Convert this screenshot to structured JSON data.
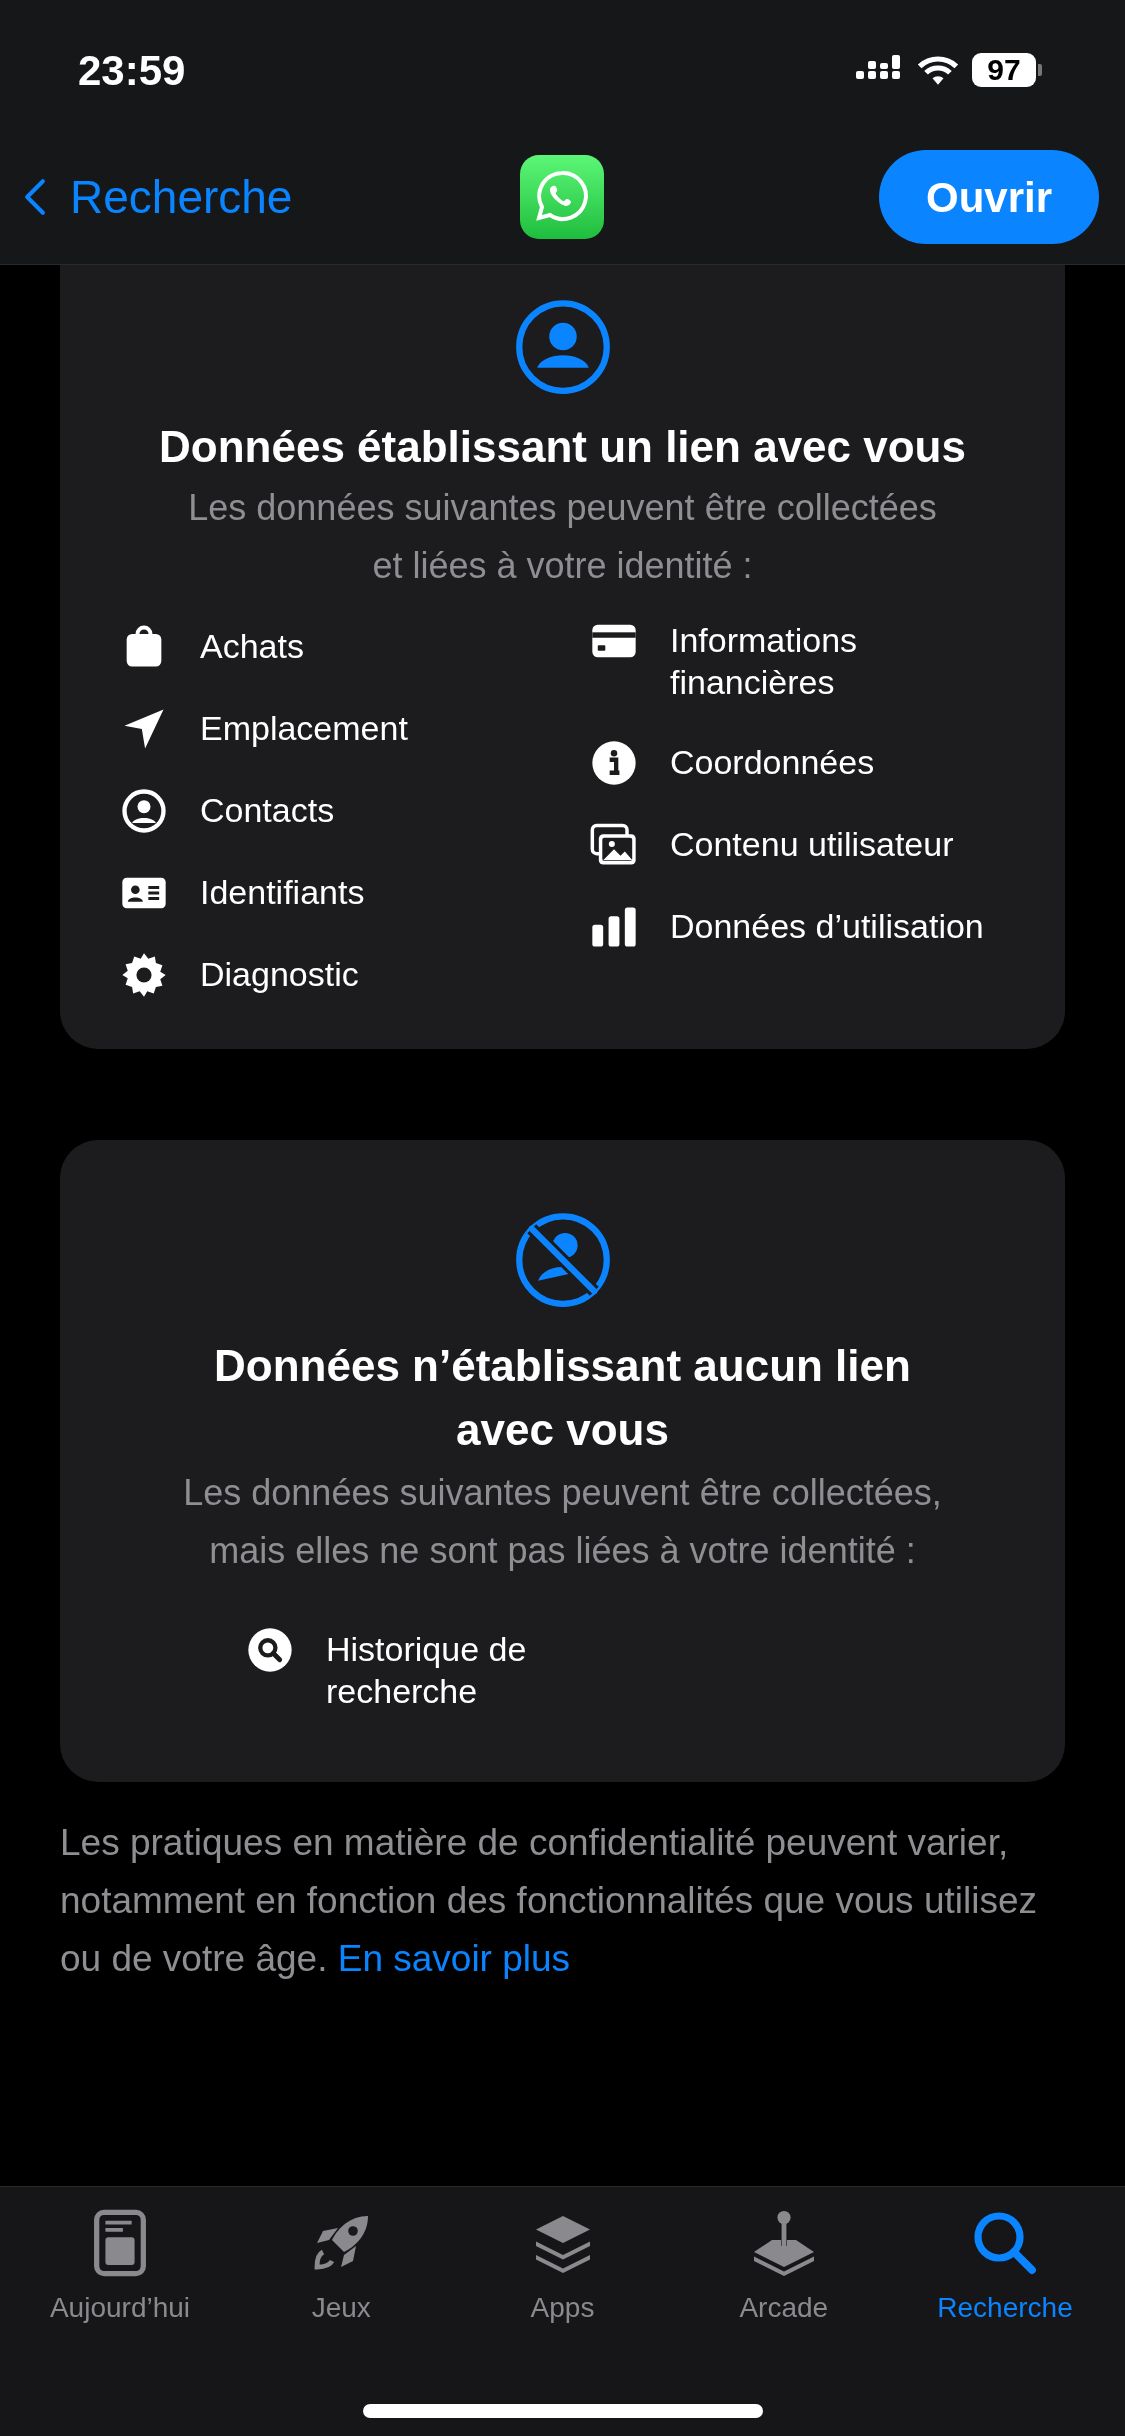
{
  "status_bar": {
    "time": "23:59",
    "battery": "97"
  },
  "nav": {
    "back": "Recherche",
    "action": "Ouvrir"
  },
  "linked_card": {
    "title": "Données établissant un lien avec vous",
    "subtitle": "Les données suivantes peuvent être collectées et liées à votre identité :",
    "left_items": [
      "Achats",
      "Emplacement",
      "Contacts",
      "Identifiants",
      "Diagnostic"
    ],
    "right_items": [
      "Informations financières",
      "Coordonnées",
      "Contenu utilisateur",
      "Données d’utilisation"
    ]
  },
  "unlinked_card": {
    "title": "Données n’établissant aucun lien avec vous",
    "subtitle": "Les données suivantes peuvent être collectées, mais elles ne sont pas liées à votre identité :",
    "items": [
      "Historique de recherche"
    ]
  },
  "footer": {
    "text": "Les pratiques en matière de confidentialité peuvent varier, notamment en fonction des fonctionnalités que vous utilisez ou de votre âge.",
    "link": "En savoir plus"
  },
  "tabs": [
    {
      "label": "Aujourd’hui",
      "selected": false
    },
    {
      "label": "Jeux",
      "selected": false
    },
    {
      "label": "Apps",
      "selected": false
    },
    {
      "label": "Arcade",
      "selected": false
    },
    {
      "label": "Recherche",
      "selected": true
    }
  ]
}
